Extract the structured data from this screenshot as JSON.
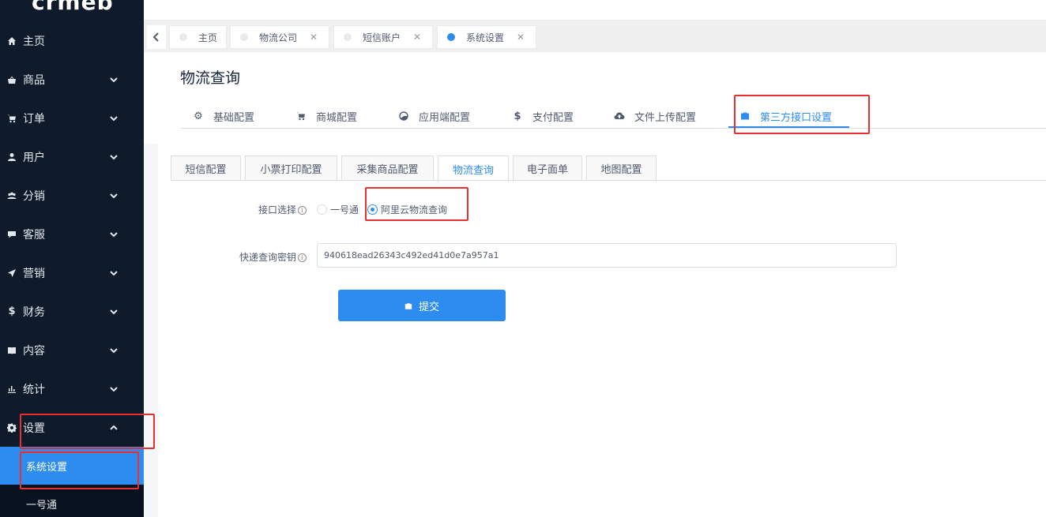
{
  "brand": {
    "logo_text": "crmeb"
  },
  "sidebar": {
    "items": [
      {
        "label": "主页",
        "icon": "home-icon",
        "expandable": false
      },
      {
        "label": "商品",
        "icon": "basket-icon",
        "expandable": true
      },
      {
        "label": "订单",
        "icon": "cart-icon",
        "expandable": true
      },
      {
        "label": "用户",
        "icon": "user-icon",
        "expandable": true
      },
      {
        "label": "分销",
        "icon": "group-icon",
        "expandable": true
      },
      {
        "label": "客服",
        "icon": "chat-icon",
        "expandable": true
      },
      {
        "label": "营销",
        "icon": "send-icon",
        "expandable": true
      },
      {
        "label": "财务",
        "icon": "dollar-icon",
        "expandable": true
      },
      {
        "label": "内容",
        "icon": "book-icon",
        "expandable": true
      },
      {
        "label": "统计",
        "icon": "bar-chart-icon",
        "expandable": true
      },
      {
        "label": "设置",
        "icon": "gear-icon",
        "expandable": true,
        "expanded": true
      }
    ],
    "submenu": [
      {
        "label": "系统设置",
        "active": true
      },
      {
        "label": "一号通",
        "active": false
      }
    ]
  },
  "page_tabs": [
    {
      "label": "主页",
      "closable": false,
      "active": false
    },
    {
      "label": "物流公司",
      "closable": true,
      "active": false
    },
    {
      "label": "短信账户",
      "closable": true,
      "active": false
    },
    {
      "label": "系统设置",
      "closable": true,
      "active": true
    }
  ],
  "page_title": "物流查询",
  "config_tabs": [
    {
      "label": "基础配置",
      "icon": "gear-icon"
    },
    {
      "label": "商城配置",
      "icon": "cart-icon"
    },
    {
      "label": "应用端配置",
      "icon": "pie-icon"
    },
    {
      "label": "支付配置",
      "icon": "dollar-icon"
    },
    {
      "label": "文件上传配置",
      "icon": "cloud-upload-icon"
    },
    {
      "label": "第三方接口设置",
      "icon": "briefcase-icon",
      "active": true
    }
  ],
  "sub_tabs": [
    {
      "label": "短信配置"
    },
    {
      "label": "小票打印配置"
    },
    {
      "label": "采集商品配置"
    },
    {
      "label": "物流查询",
      "active": true
    },
    {
      "label": "电子面单"
    },
    {
      "label": "地图配置"
    }
  ],
  "form": {
    "interface_label": "接口选择",
    "options": [
      {
        "label": "一号通",
        "checked": false
      },
      {
        "label": "阿里云物流查询",
        "checked": true
      }
    ],
    "key_label": "快递查询密钥",
    "key_value": "940618ead26343c492ed41d0e7a957a1",
    "submit_label": "提交"
  },
  "colors": {
    "accent": "#2d8cf0",
    "sidebar_bg": "#0f1a2b",
    "annotation": "#e8312f"
  }
}
